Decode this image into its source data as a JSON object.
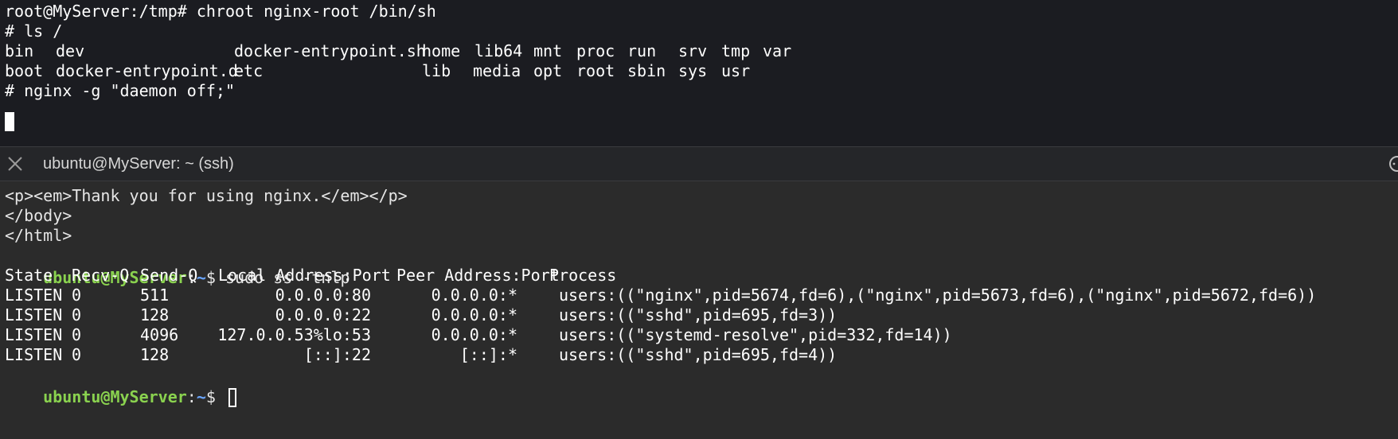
{
  "top_pane": {
    "lines": [
      "root@MyServer:/tmp# chroot nginx-root /bin/sh",
      "# ls /"
    ],
    "ls_row1": [
      "bin",
      "dev",
      "docker-entrypoint.sh",
      "home",
      "lib64",
      "mnt",
      "proc",
      "run",
      "srv",
      "tmp",
      "var"
    ],
    "ls_row2": [
      "boot",
      "docker-entrypoint.d",
      "etc",
      "lib",
      "media",
      "opt",
      "root",
      "sbin",
      "sys",
      "usr"
    ],
    "last_command": "# nginx -g \"daemon off;\""
  },
  "tab": {
    "title": "ubuntu@MyServer: ~ (ssh)",
    "close_icon": "close-icon",
    "more_icon": "more-icon"
  },
  "bottom_pane": {
    "html_lines": [
      "<p><em>Thank you for using nginx.</em></p>",
      "</body>",
      "</html>"
    ],
    "prompt": {
      "user_host": "ubuntu@MyServer",
      "sep": ":",
      "path": "~",
      "symbol": "$ "
    },
    "command": "sudo ss -tnlp",
    "ss_header": {
      "state": "State",
      "recvq": "Recv-Q",
      "sendq": "Send-Q",
      "local": "Local Address:Port",
      "peer": "Peer Address:Port",
      "process": "Process"
    },
    "ss_rows": [
      {
        "state": "LISTEN",
        "recvq": "0",
        "sendq": "511",
        "local": "0.0.0.0:80",
        "peer": "0.0.0.0:*",
        "process": "users:((\"nginx\",pid=5674,fd=6),(\"nginx\",pid=5673,fd=6),(\"nginx\",pid=5672,fd=6))"
      },
      {
        "state": "LISTEN",
        "recvq": "0",
        "sendq": "128",
        "local": "0.0.0.0:22",
        "peer": "0.0.0.0:*",
        "process": "users:((\"sshd\",pid=695,fd=3))"
      },
      {
        "state": "LISTEN",
        "recvq": "0",
        "sendq": "4096",
        "local": "127.0.0.53%lo:53",
        "peer": "0.0.0.0:*",
        "process": "users:((\"systemd-resolve\",pid=332,fd=14))"
      },
      {
        "state": "LISTEN",
        "recvq": "0",
        "sendq": "128",
        "local": "[::]:22",
        "peer": "[::]:*",
        "process": "users:((\"sshd\",pid=695,fd=4))"
      }
    ]
  },
  "colors": {
    "prompt_user": "#8ad24f",
    "prompt_path": "#6aa6ff",
    "background_top": "#1b1c21",
    "background_bottom": "#2b2b2b"
  }
}
